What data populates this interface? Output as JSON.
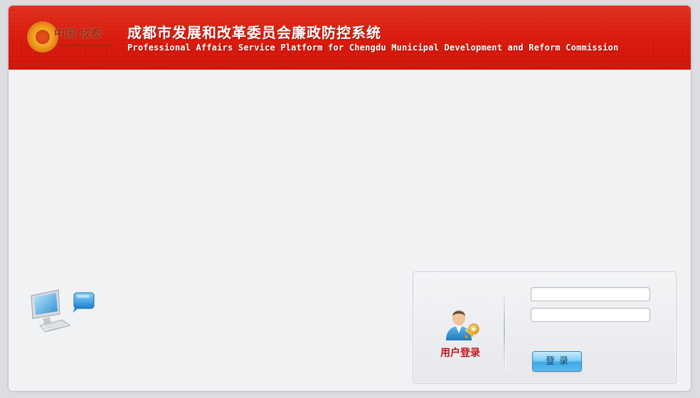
{
  "header": {
    "logo_text": "中国·成都",
    "logo_url": "www.chengdu.gov.cn",
    "title_cn": "成都市发展和改革委员会廉政防控系统",
    "title_en": "Professional Affairs Service Platform for Chengdu Municipal Development and Reform Commission"
  },
  "login": {
    "label": "用户登录",
    "username_value": "",
    "password_value": "",
    "button_label": "登录"
  },
  "icons": {
    "logo": "city-logo-icon",
    "computer": "computer-network-icon",
    "user": "user-key-icon"
  },
  "colors": {
    "header_red": "#d81a0c",
    "login_label_red": "#c41313",
    "button_blue": "#3fa8e3"
  }
}
